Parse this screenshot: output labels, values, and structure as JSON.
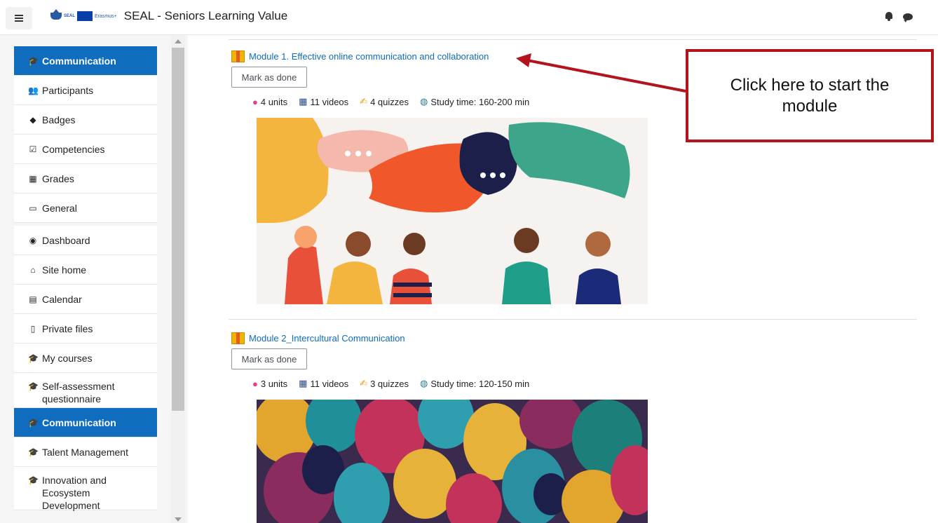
{
  "header": {
    "logo_seal_text": "SEAL",
    "logo_erasmus_text": "Erasmus+",
    "site_title": "SEAL - Seniors Learning Value"
  },
  "sidebar": {
    "items": [
      {
        "label": "Communication",
        "icon": "graduation-cap-icon",
        "active": true
      },
      {
        "label": "Participants",
        "icon": "users-icon"
      },
      {
        "label": "Badges",
        "icon": "shield-icon"
      },
      {
        "label": "Competencies",
        "icon": "checkbox-icon"
      },
      {
        "label": "Grades",
        "icon": "table-icon"
      },
      {
        "label": "General",
        "icon": "folder-icon"
      },
      {
        "label": "Dashboard",
        "icon": "dashboard-icon"
      },
      {
        "label": "Site home",
        "icon": "home-icon"
      },
      {
        "label": "Calendar",
        "icon": "calendar-icon"
      },
      {
        "label": "Private files",
        "icon": "file-icon"
      },
      {
        "label": "My courses",
        "icon": "graduation-cap-icon"
      },
      {
        "label": "Self-assessment questionnaire",
        "icon": "graduation-cap-icon"
      },
      {
        "label": "Communication",
        "icon": "graduation-cap-icon",
        "active": true
      },
      {
        "label": "Talent Management",
        "icon": "graduation-cap-icon"
      },
      {
        "label": "Innovation and Ecosystem Development",
        "icon": "graduation-cap-icon"
      }
    ]
  },
  "modules": [
    {
      "title": "Module 1. Effective online communication and collaboration",
      "mark_label": "Mark as done",
      "units": "4 units",
      "videos": "11 videos",
      "quizzes": "4 quizzes",
      "study_time": "Study time: 160-200 min"
    },
    {
      "title": "Module 2_Intercultural Communication",
      "mark_label": "Mark as done",
      "units": "3 units",
      "videos": "11 videos",
      "quizzes": "3 quizzes",
      "study_time": "Study time: 120-150 min"
    }
  ],
  "annotation": {
    "text": "Click here to start the module",
    "color": "#b3141b"
  },
  "colors": {
    "accent": "#0f6cbf",
    "link": "#0f6cbf"
  }
}
